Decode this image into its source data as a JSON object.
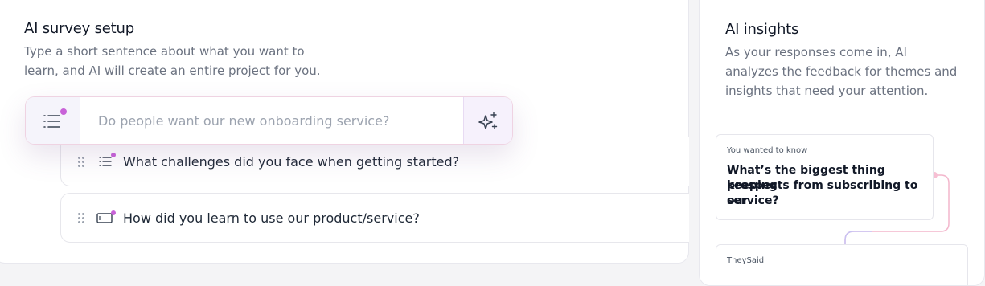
{
  "survey_setup": {
    "title": "AI survey setup",
    "description_line1": "Type a short sentence about what you want to",
    "description_line2": "learn, and AI will create an entire project for you.",
    "prompt": {
      "placeholder": "Do people want our new onboarding service?",
      "value": "",
      "left_icon": "list-icon",
      "right_icon": "sparkle-icon"
    },
    "questions": [
      {
        "text": "What challenges did you face when getting started?",
        "icon": "list-icon"
      },
      {
        "text": "How did you learn to use our product/service?",
        "icon": "text-input-icon"
      }
    ]
  },
  "insights": {
    "title": "AI insights",
    "description_line1": "As your responses come in, AI",
    "description_line2": "analyzes the feedback for themes and",
    "description_line3": "insights that need your attention.",
    "card_label": "You wanted to know",
    "card_question_line1": "What’s the biggest thing keeping",
    "card_question_line2": "prospects from subscribing to our",
    "card_question_line3": "service?",
    "bottom_label": "TheySaid"
  },
  "colors": {
    "accent_dot": "#c862d8",
    "connector_pink": "#f3b6cc",
    "connector_lavender": "#c8c2f3",
    "icon_dark": "#374151"
  }
}
